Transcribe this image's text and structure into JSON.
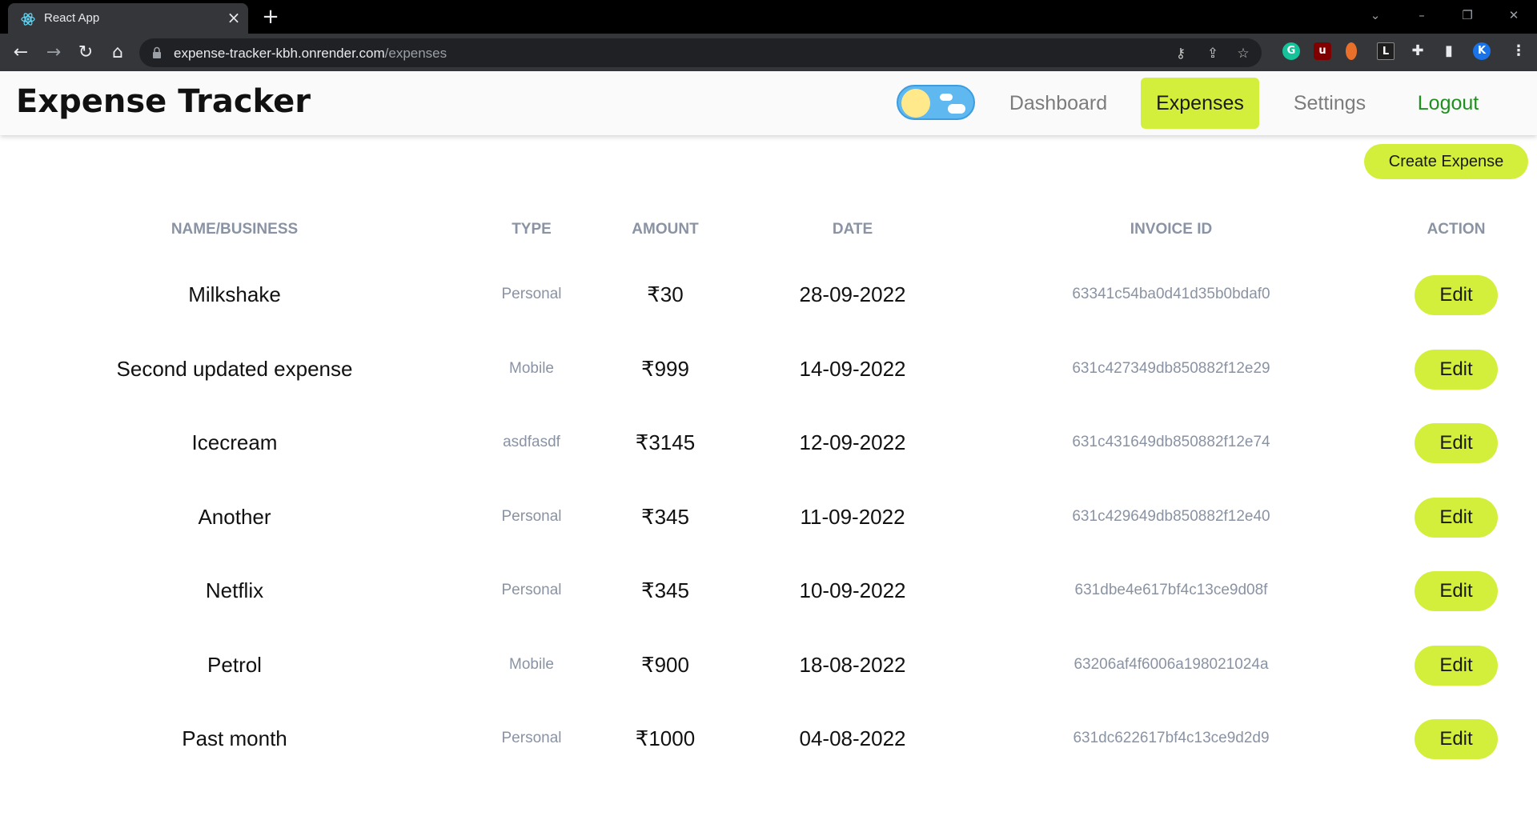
{
  "browser": {
    "tab_title": "React App",
    "url_host": "expense-tracker-kbh.onrender.com",
    "url_path": "/expenses",
    "profile_initial": "K"
  },
  "header": {
    "brand": "Expense Tracker",
    "nav": {
      "dashboard": "Dashboard",
      "expenses": "Expenses",
      "settings": "Settings",
      "logout": "Logout"
    },
    "active_nav": "expenses",
    "accent_color": "#d3ef3c",
    "logout_color": "#1f8f1f"
  },
  "main": {
    "create_button": "Create Expense",
    "columns": {
      "name": "NAME/BUSINESS",
      "type": "TYPE",
      "amount": "AMOUNT",
      "date": "DATE",
      "invoice": "INVOICE ID",
      "action": "ACTION"
    },
    "edit_label": "Edit",
    "rows": [
      {
        "name": "Milkshake",
        "type": "Personal",
        "amount": "₹30",
        "date": "28-09-2022",
        "invoice": "63341c54ba0d41d35b0bdaf0"
      },
      {
        "name": "Second updated expense",
        "type": "Mobile",
        "amount": "₹999",
        "date": "14-09-2022",
        "invoice": "631c427349db850882f12e29"
      },
      {
        "name": "Icecream",
        "type": "asdfasdf",
        "amount": "₹3145",
        "date": "12-09-2022",
        "invoice": "631c431649db850882f12e74"
      },
      {
        "name": "Another",
        "type": "Personal",
        "amount": "₹345",
        "date": "11-09-2022",
        "invoice": "631c429649db850882f12e40"
      },
      {
        "name": "Netflix",
        "type": "Personal",
        "amount": "₹345",
        "date": "10-09-2022",
        "invoice": "631dbe4e617bf4c13ce9d08f"
      },
      {
        "name": "Petrol",
        "type": "Mobile",
        "amount": "₹900",
        "date": "18-08-2022",
        "invoice": "63206af4f6006a198021024a"
      },
      {
        "name": "Past month",
        "type": "Personal",
        "amount": "₹1000",
        "date": "04-08-2022",
        "invoice": "631dc622617bf4c13ce9d2d9"
      }
    ]
  }
}
